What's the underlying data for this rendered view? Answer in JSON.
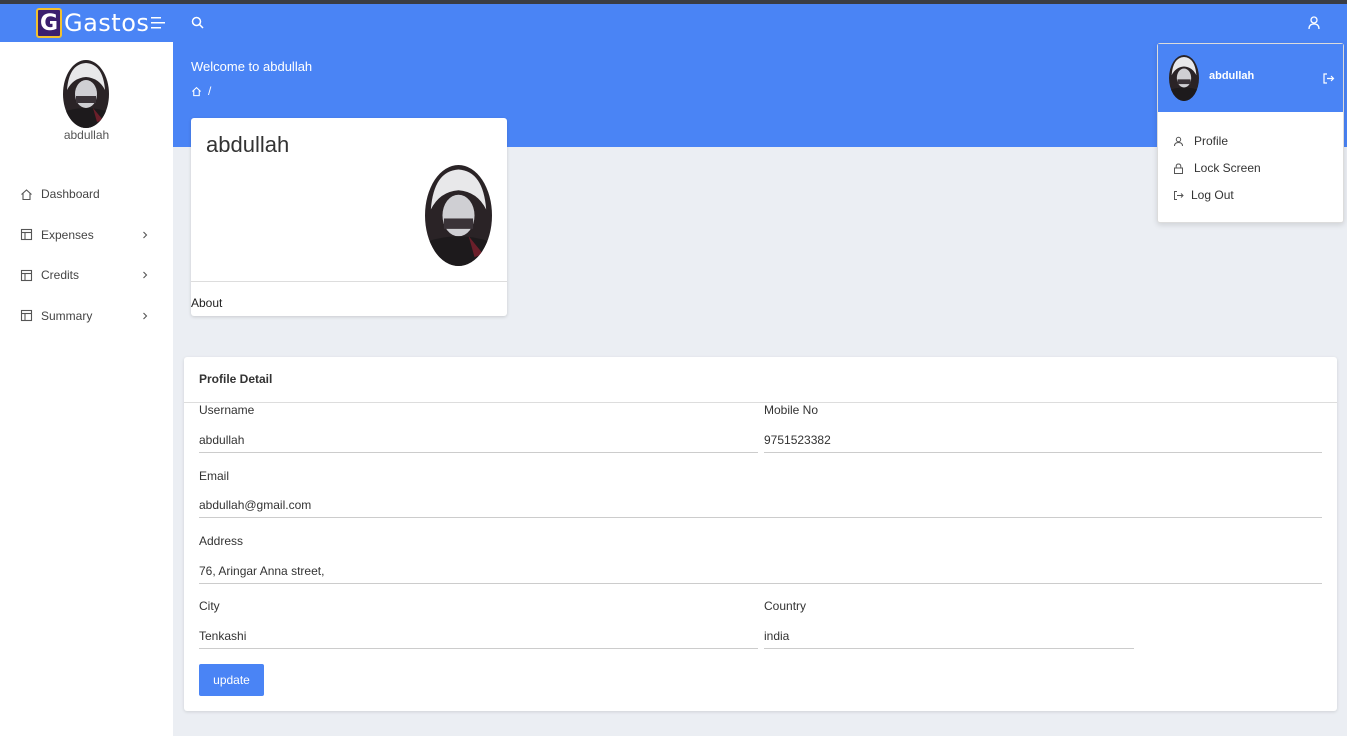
{
  "app": {
    "logo_letter": "G",
    "logo_text": "Gastos"
  },
  "hero": {
    "welcome": "Welcome to abdullah",
    "breadcrumb_sep": "/"
  },
  "sidebar": {
    "user_name": "abdullah",
    "items": [
      {
        "label": "Dashboard",
        "icon": "home-icon",
        "has_submenu": false
      },
      {
        "label": "Expenses",
        "icon": "layout-icon",
        "has_submenu": true
      },
      {
        "label": "Credits",
        "icon": "layout-icon",
        "has_submenu": true
      },
      {
        "label": "Summary",
        "icon": "layout-icon",
        "has_submenu": true
      }
    ]
  },
  "profile_card": {
    "name": "abdullah",
    "about_label": "About"
  },
  "profile_detail": {
    "title": "Profile Detail",
    "username_label": "Username",
    "username_value": "abdullah",
    "mobile_label": "Mobile No",
    "mobile_value": "9751523382",
    "email_label": "Email",
    "email_value": "abdullah@gmail.com",
    "address_label": "Address",
    "address_value": "76, Aringar Anna street,",
    "city_label": "City",
    "city_value": "Tenkashi",
    "country_label": "Country",
    "country_value": "india",
    "update_label": "update"
  },
  "user_menu": {
    "name": "abdullah",
    "items": [
      "Profile",
      "Lock Screen",
      "Log Out"
    ]
  },
  "colors": {
    "primary": "#4a84f5",
    "background": "#ebeef3"
  }
}
